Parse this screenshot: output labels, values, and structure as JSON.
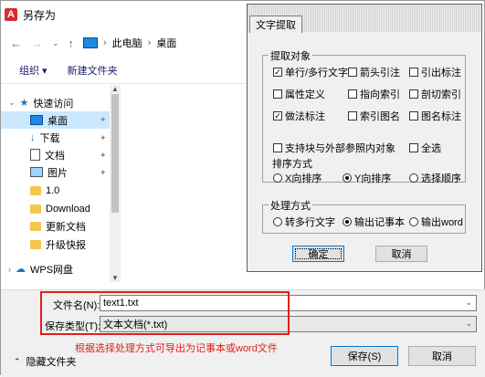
{
  "saveas": {
    "title": "另存为",
    "breadcrumb_root": "此电脑",
    "breadcrumb_leaf": "桌面",
    "cmd_organize": "组织",
    "cmd_new_folder": "新建文件夹",
    "tree": [
      {
        "label": "快速访问",
        "icon": "star-icon"
      },
      {
        "label": "桌面",
        "icon": "desktop-icon",
        "selected": true
      },
      {
        "label": "下载",
        "icon": "download-icon"
      },
      {
        "label": "文档",
        "icon": "document-icon"
      },
      {
        "label": "图片",
        "icon": "picture-icon"
      },
      {
        "label": "1.0",
        "icon": "folder-icon"
      },
      {
        "label": "Download",
        "icon": "folder-icon"
      },
      {
        "label": "更新文档",
        "icon": "folder-icon"
      },
      {
        "label": "升级快报",
        "icon": "folder-icon"
      },
      {
        "label": "WPS网盘",
        "icon": "cloud-icon"
      }
    ],
    "filename_label": "文件名(N):",
    "filename_value": "text1.txt",
    "filetype_label": "保存类型(T):",
    "filetype_value": "文本文档(*.txt)",
    "hide_folders": "隐藏文件夹",
    "save_button": "保存(S)",
    "cancel_button": "取消",
    "annotation": "根据选择处理方式可导出为记事本或word文件",
    "annotation_color": "#e0201b"
  },
  "dialog": {
    "tab": "文字提取",
    "extract_group": "提取对象",
    "checkboxes": [
      {
        "label": "单行/多行文字",
        "checked": true
      },
      {
        "label": "箭头引注",
        "checked": false
      },
      {
        "label": "引出标注",
        "checked": false
      },
      {
        "label": "属性定义",
        "checked": false
      },
      {
        "label": "指向索引",
        "checked": false
      },
      {
        "label": "剖切索引",
        "checked": false
      },
      {
        "label": "做法标注",
        "checked": true
      },
      {
        "label": "索引图名",
        "checked": false
      },
      {
        "label": "图名标注",
        "checked": false
      }
    ],
    "support_block": "支持块与外部参照内对象",
    "select_all": "全选",
    "sort_group": "排序方式",
    "sort_options": [
      {
        "label": "X向排序",
        "selected": false
      },
      {
        "label": "Y向排序",
        "selected": true
      },
      {
        "label": "选择顺序",
        "selected": false
      }
    ],
    "process_group": "处理方式",
    "process_options": [
      {
        "label": "转多行文字",
        "selected": false
      },
      {
        "label": "输出记事本",
        "selected": true
      },
      {
        "label": "输出word",
        "selected": false
      }
    ],
    "ok_button": "确定",
    "cancel_button": "取消"
  }
}
